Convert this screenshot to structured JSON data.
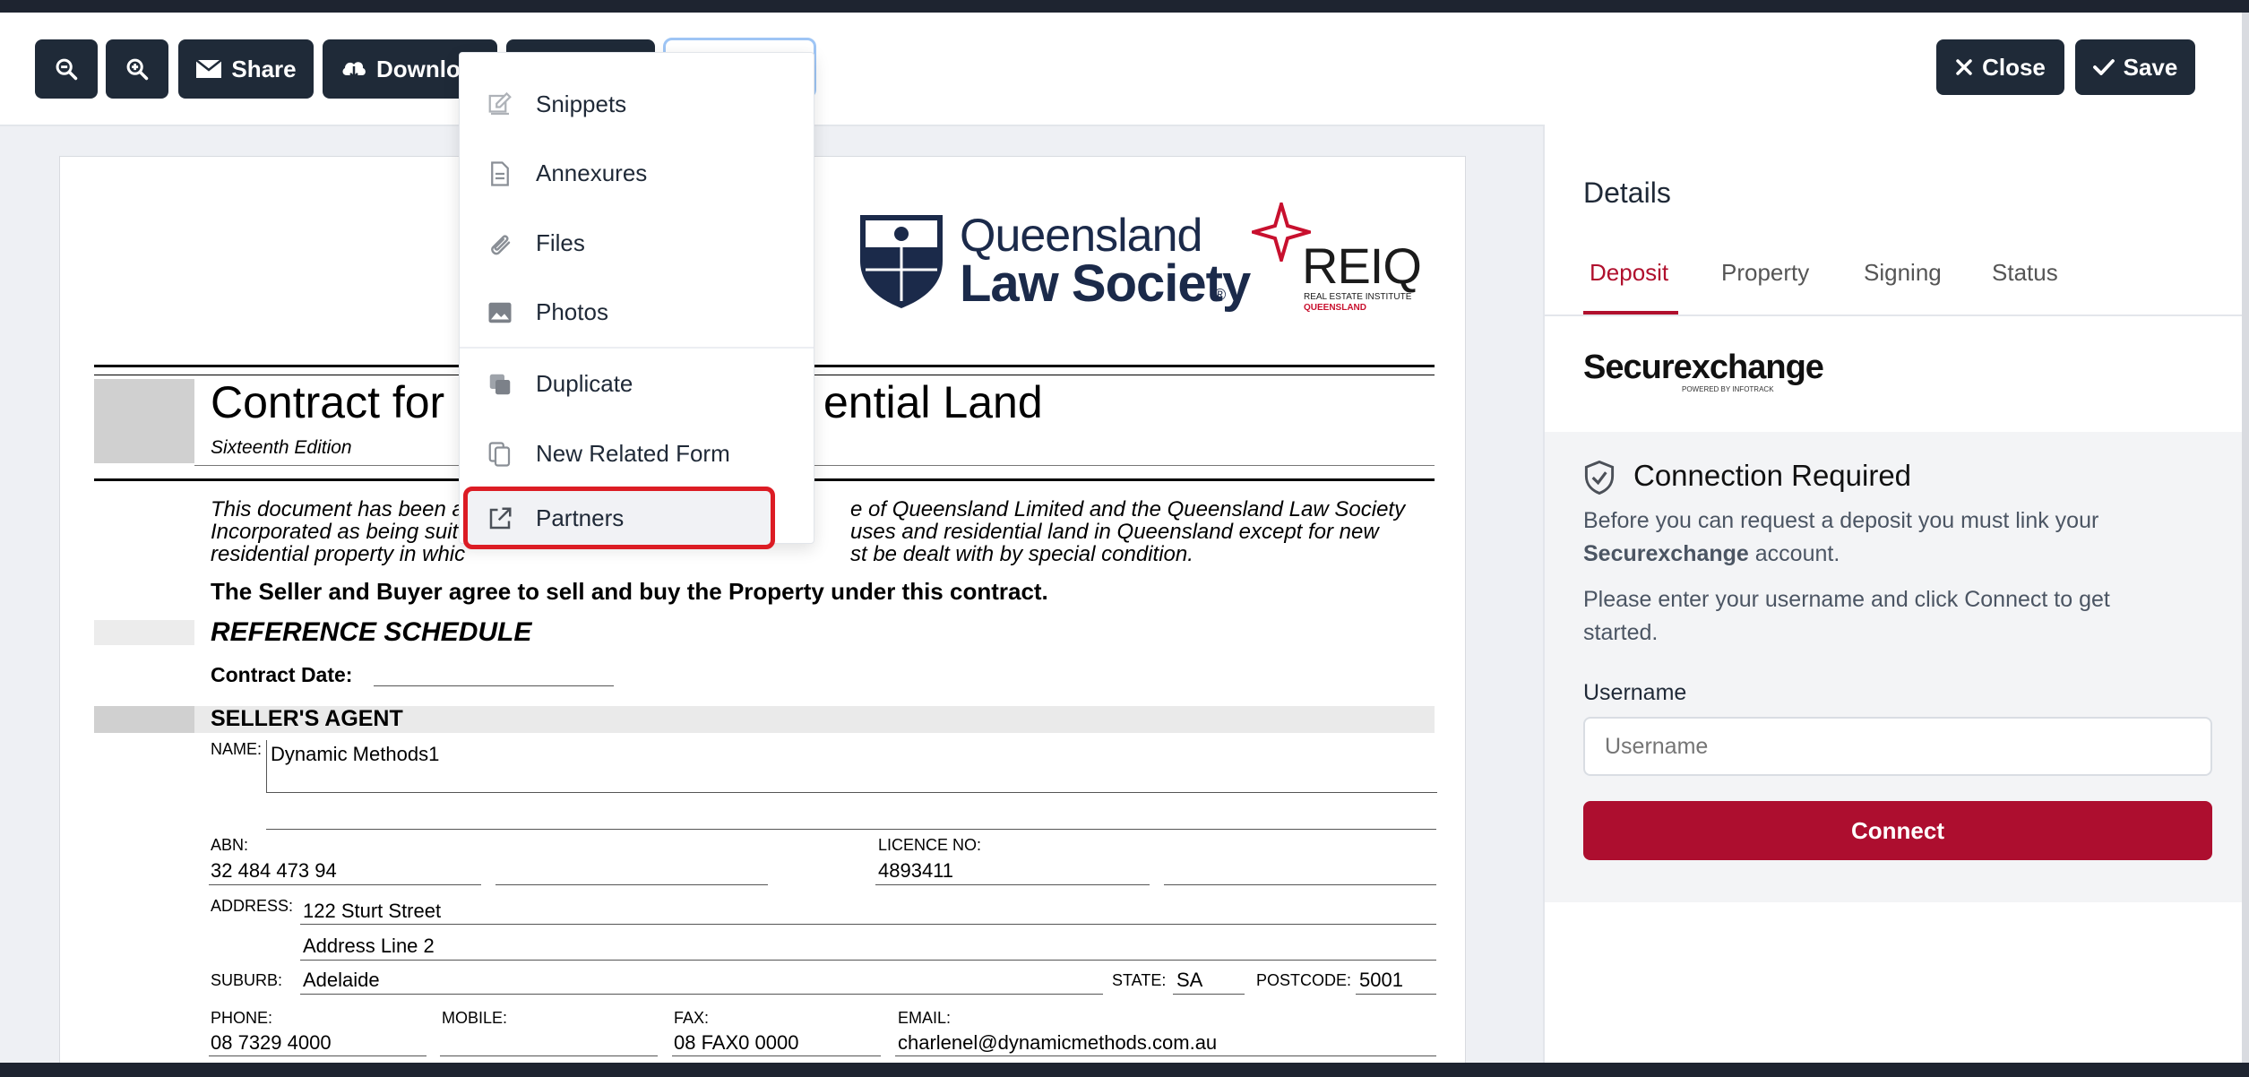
{
  "toolbar": {
    "zoom_out_icon": "zoom-out-icon",
    "zoom_in_icon": "zoom-in-icon",
    "share_label": "Share",
    "download_label": "Download",
    "close_label": "Close",
    "save_label": "Save"
  },
  "menu": {
    "items": [
      {
        "label": "Snippets",
        "icon": "pencil-icon"
      },
      {
        "label": "Annexures",
        "icon": "document-icon"
      },
      {
        "label": "Files",
        "icon": "paperclip-icon"
      },
      {
        "label": "Photos",
        "icon": "image-icon"
      },
      {
        "label": "Duplicate",
        "icon": "duplicate-icon"
      },
      {
        "label": "New Related Form",
        "icon": "copy-icon"
      },
      {
        "label": "Partners",
        "icon": "external-link-icon"
      }
    ]
  },
  "document": {
    "logo_qls_line1": "Queensland",
    "logo_qls_line2": "Law Society",
    "logo_qls_reg": "®",
    "logo_reiq": "REIQ",
    "logo_reiq_sub1": "REAL ESTATE INSTITUTE",
    "logo_reiq_sub2": "QUEENSLAND",
    "title_left": "Contract for I",
    "title_right": "ential Land",
    "edition": "Sixteenth Edition",
    "intro_1a": "This document has been a",
    "intro_1b": "e of Queensland Limited and the Queensland Law Society",
    "intro_2a": "Incorporated as being suit",
    "intro_2b": "uses and residential land in Queensland except for new",
    "intro_3a": "residential property in whic",
    "intro_3b": "st be dealt with by special condition.",
    "agree_text": "The Seller and Buyer agree to sell and buy the Property under this contract.",
    "reference_schedule": "REFERENCE SCHEDULE",
    "contract_date_label": "Contract Date:",
    "sellers_agent": "SELLER'S AGENT",
    "name_label": "NAME:",
    "name_value": "Dynamic Methods1",
    "abn_label": "ABN:",
    "abn_value": "32 484 473 94",
    "licence_label": "LICENCE NO:",
    "licence_value": "4893411",
    "address_label": "ADDRESS:",
    "address_line1": "122 Sturt Street",
    "address_line2": "Address Line 2",
    "suburb_label": "SUBURB:",
    "suburb_value": "Adelaide",
    "state_label": "STATE:",
    "state_value": "SA",
    "postcode_label": "POSTCODE:",
    "postcode_value": "5001",
    "phone_label": "PHONE:",
    "phone_value": "08 7329 4000",
    "mobile_label": "MOBILE:",
    "mobile_value": "",
    "fax_label": "FAX:",
    "fax_value": "08 FAX0 0000",
    "email_label": "EMAIL:",
    "email_value": "charlenel@dynamicmethods.com.au"
  },
  "panel": {
    "title": "Details",
    "tabs": [
      "Deposit",
      "Property",
      "Signing",
      "Status"
    ],
    "active_tab": "Deposit",
    "brand": "Securexchange",
    "brand_sub": "POWERED BY INFOTRACK",
    "connection_title": "Connection Required",
    "desc_1": "Before you can request a deposit you must link your",
    "desc_bold": "Securexchange",
    "desc_2": " account.",
    "desc_3a": "Please enter your username and click Connect to get",
    "desc_3b": "started.",
    "username_label": "Username",
    "username_placeholder": "Username",
    "username_value": "",
    "connect_label": "Connect"
  },
  "colors": {
    "toolbar_button": "#1f2a38",
    "accent_red": "#ad0e2f",
    "highlight_red": "#dc1c24",
    "qls_navy": "#1b2a4a",
    "reiq_red": "#c8102e"
  }
}
